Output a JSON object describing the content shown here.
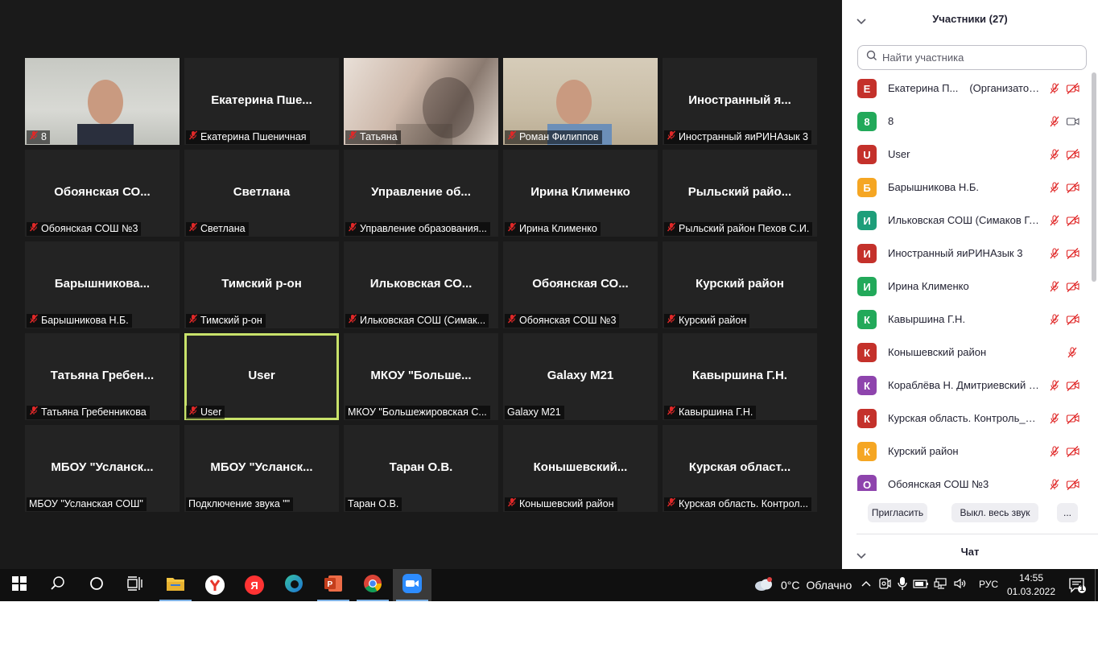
{
  "gallery": {
    "tiles": [
      {
        "big": "",
        "label": "8",
        "muted": true
      },
      {
        "big": "Екатерина  Пше...",
        "label": "Екатерина Пшеничная",
        "muted": true
      },
      {
        "big": "",
        "label": "Татьяна",
        "muted": true
      },
      {
        "big": "",
        "label": "Роман Филиппов",
        "muted": true
      },
      {
        "big": "Иностранный  я...",
        "label": "Иностранный яиРИНАзык 3",
        "muted": true
      },
      {
        "big": "Обоянская  СО...",
        "label": "Обоянская СОШ №3",
        "muted": true
      },
      {
        "big": "Светлана",
        "label": "Светлана",
        "muted": true
      },
      {
        "big": "Управление  об...",
        "label": "Управление образования...",
        "muted": true
      },
      {
        "big": "Ирина Клименко",
        "label": "Ирина Клименко",
        "muted": true
      },
      {
        "big": "Рыльский  райо...",
        "label": "Рыльский район Пехов С.И.",
        "muted": true
      },
      {
        "big": "Барышникова...",
        "label": "Барышникова Н.Б.",
        "muted": true
      },
      {
        "big": "Тимский р-он",
        "label": "Тимский р-он",
        "muted": true
      },
      {
        "big": "Ильковская  СО...",
        "label": "Ильковская СОШ (Симак...",
        "muted": true
      },
      {
        "big": "Обоянская  СО...",
        "label": "Обоянская СОШ №3",
        "muted": true
      },
      {
        "big": "Курский район",
        "label": "Курский район",
        "muted": true
      },
      {
        "big": "Татьяна  Гребен...",
        "label": "Татьяна Гребенникова",
        "muted": true
      },
      {
        "big": "User",
        "label": "User",
        "muted": true,
        "active": true
      },
      {
        "big": "МКОУ  \"Больше...",
        "label": "МКОУ \"Большежировская С...",
        "muted": false
      },
      {
        "big": "Galaxy M21",
        "label": "Galaxy M21",
        "muted": false
      },
      {
        "big": "Кавыршина Г.Н.",
        "label": "Кавыршина Г.Н.",
        "muted": true
      },
      {
        "big": "МБОУ  \"Усланск...",
        "label": "МБОУ \"Усланская СОШ\"",
        "muted": false
      },
      {
        "big": "МБОУ  \"Усланск...",
        "label": "Подключение звука \"\"",
        "muted": false
      },
      {
        "big": "Таран О.В.",
        "label": "Таран О.В.",
        "muted": false
      },
      {
        "big": "Конышевский...",
        "label": "Конышевский район",
        "muted": true
      },
      {
        "big": "Курская  област...",
        "label": "Курская область. Контрол...",
        "muted": true
      }
    ]
  },
  "panel": {
    "title": "Участники (27)",
    "search_placeholder": "Найти участника",
    "participants": [
      {
        "initial": "Е",
        "color": "#c4312b",
        "name": "Екатерина П...",
        "role": "(Организатор, я)",
        "mic": "muted",
        "cam": "off"
      },
      {
        "initial": "8",
        "color": "#22a95a",
        "name": "8",
        "role": "",
        "mic": "muted",
        "cam": "on"
      },
      {
        "initial": "U",
        "color": "#c4312b",
        "name": "User",
        "role": "",
        "mic": "muted",
        "cam": "off"
      },
      {
        "initial": "Б",
        "color": "#f5a623",
        "name": "Барышникова Н.Б.",
        "role": "",
        "mic": "muted",
        "cam": "off"
      },
      {
        "initial": "И",
        "color": "#1e9e7a",
        "name": "Ильковская СОШ (Симаков Г. ...",
        "role": "",
        "mic": "muted",
        "cam": "off"
      },
      {
        "initial": "И",
        "color": "#c4312b",
        "name": "Иностранный яиРИНАзык 3",
        "role": "",
        "mic": "muted",
        "cam": "off"
      },
      {
        "initial": "И",
        "color": "#22a95a",
        "name": "Ирина Клименко",
        "role": "",
        "mic": "muted",
        "cam": "off"
      },
      {
        "initial": "К",
        "color": "#22a95a",
        "name": "Кавыршина Г.Н.",
        "role": "",
        "mic": "muted",
        "cam": "off"
      },
      {
        "initial": "К",
        "color": "#c4312b",
        "name": "Конышевский район",
        "role": "",
        "mic": "muted",
        "cam": "none"
      },
      {
        "initial": "К",
        "color": "#8e44ad",
        "name": "Кораблёва Н. Дмитриевский р...",
        "role": "",
        "mic": "muted",
        "cam": "off"
      },
      {
        "initial": "К",
        "color": "#c4312b",
        "name": "Курская область. Контроль_на...",
        "role": "",
        "mic": "muted",
        "cam": "off"
      },
      {
        "initial": "К",
        "color": "#f5a623",
        "name": "Курский район",
        "role": "",
        "mic": "muted",
        "cam": "off"
      },
      {
        "initial": "О",
        "color": "#8e44ad",
        "name": "Обоянская СОШ №3",
        "role": "",
        "mic": "muted",
        "cam": "off"
      }
    ],
    "invite_label": "Пригласить",
    "mute_all_label": "Выкл. весь звук",
    "more_label": "...",
    "chat_title": "Чат"
  },
  "taskbar": {
    "weather_temp": "0°C",
    "weather_text": "Облачно",
    "lang": "РУС",
    "time": "14:55",
    "date": "01.03.2022",
    "notification_count": "1",
    "colors": {
      "yandex_browser": "#e8372c",
      "yandex": "#ff3333",
      "powerpoint": "#c43e1c",
      "zoom": "#2d8cff",
      "explorer": "#f4c542"
    }
  }
}
